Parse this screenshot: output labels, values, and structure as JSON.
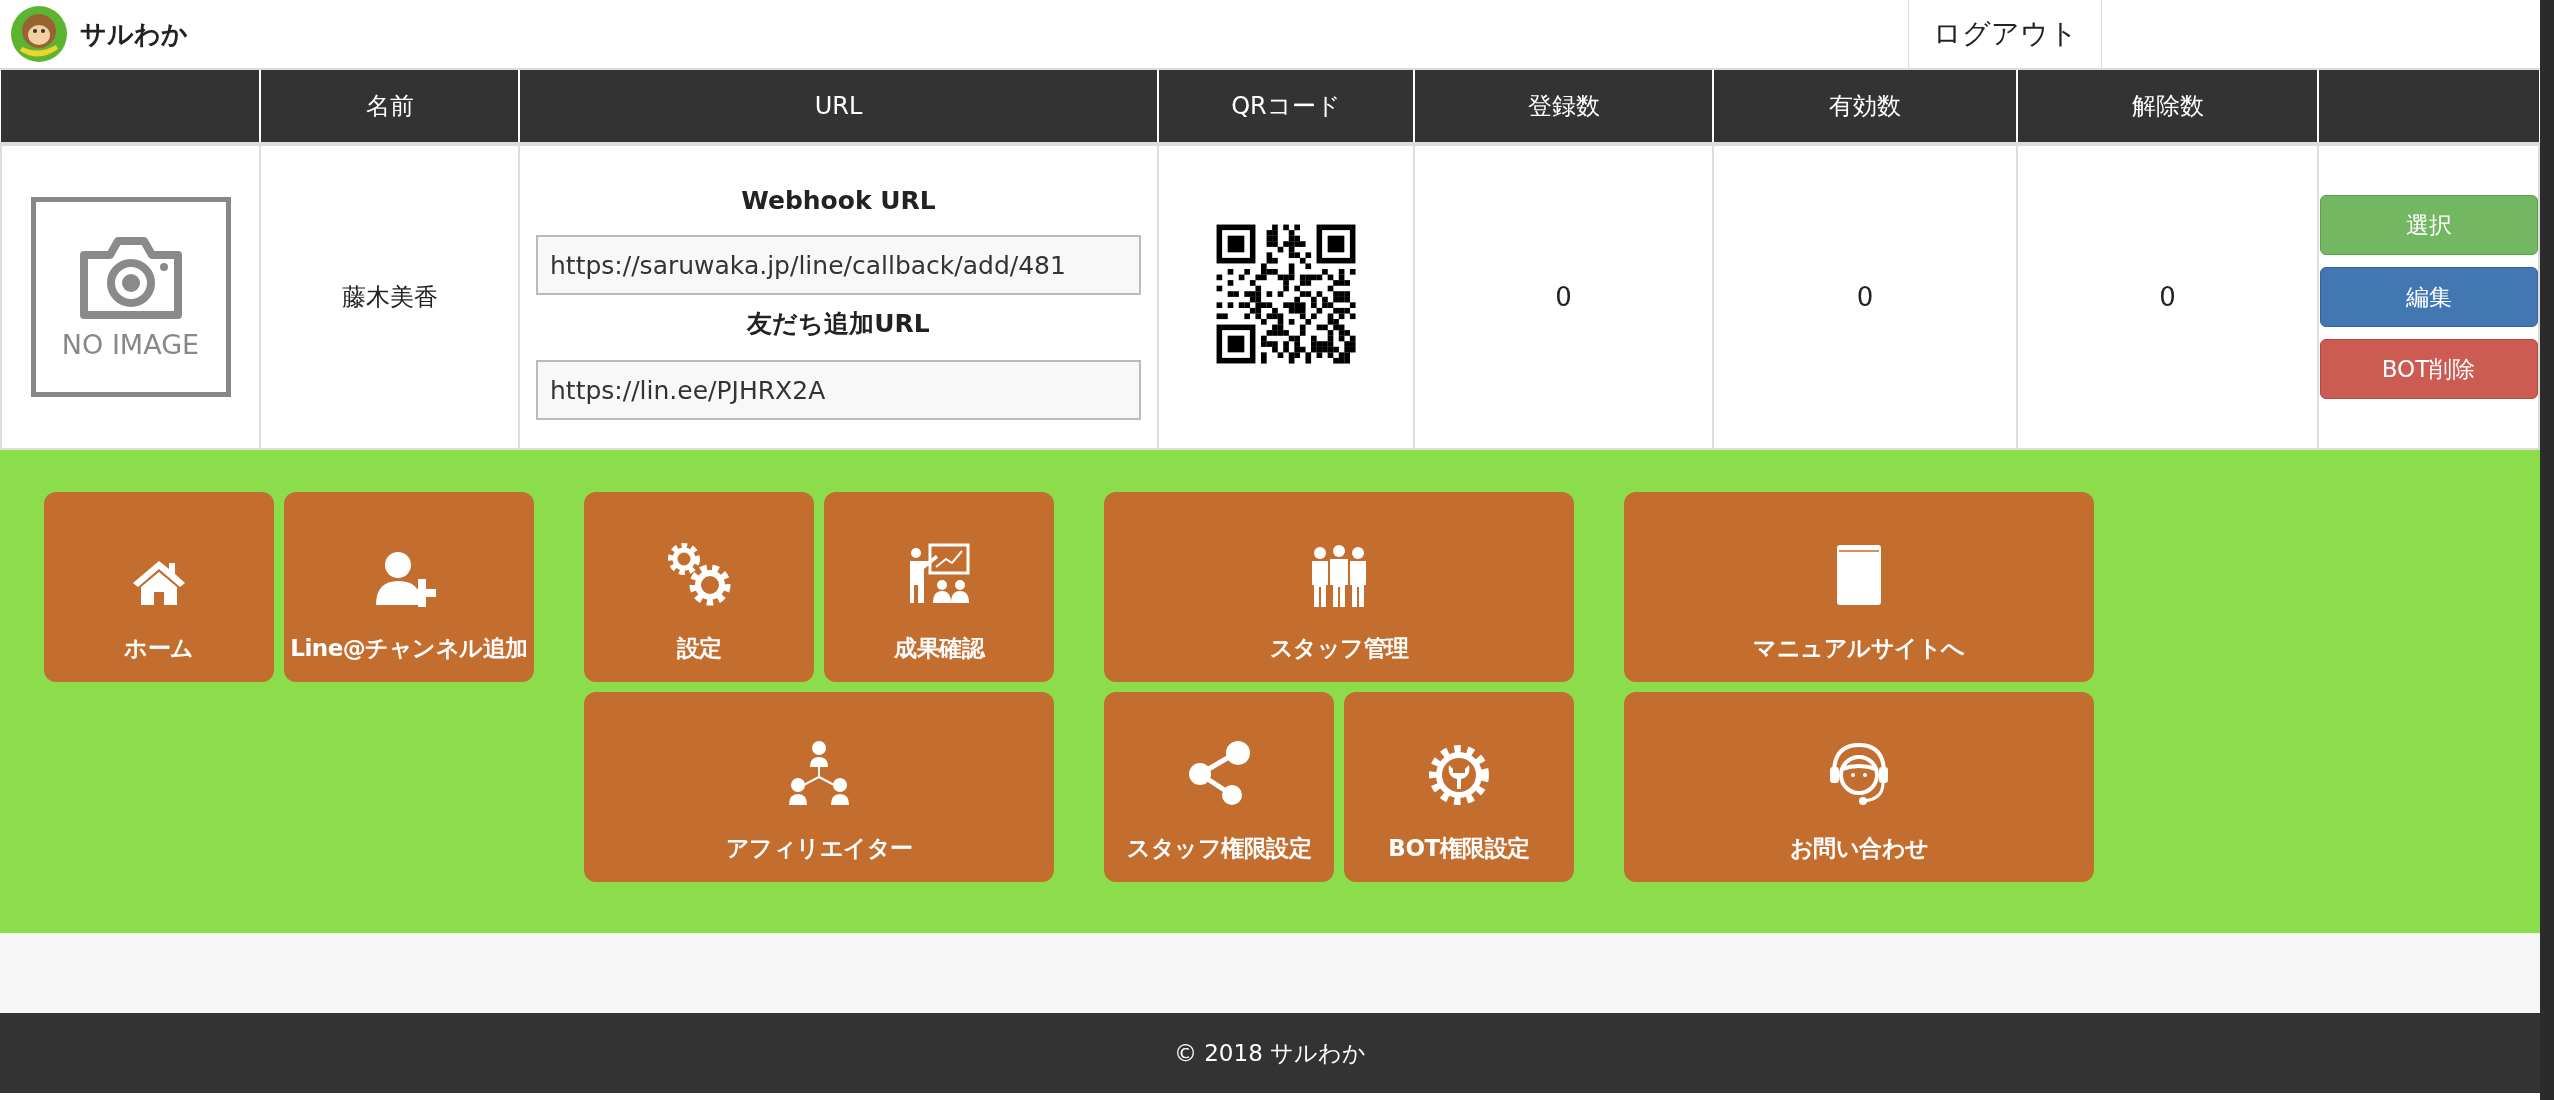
{
  "header": {
    "logo_text": "サルわか",
    "logout": "ログアウト"
  },
  "table": {
    "columns": [
      {},
      {
        "label": "名前"
      },
      {
        "label": "URL"
      },
      {
        "label": "QRコード"
      },
      {
        "label": "登録数"
      },
      {
        "label": "有効数"
      },
      {
        "label": "解除数"
      },
      {}
    ],
    "rows": [
      {
        "image_text": "NO IMAGE",
        "name": "藤木美香",
        "webhook_label": "Webhook URL",
        "webhook_url": "https://saruwaka.jp/line/callback/add/481",
        "friend_label": "友だち追加URL",
        "friend_url": "https://lin.ee/PJHRX2A",
        "registered": "0",
        "active": "0",
        "removed": "0",
        "actions": [
          {
            "label": "選択",
            "kind": "select"
          },
          {
            "label": "編集",
            "kind": "edit"
          },
          {
            "label": "BOT削除",
            "kind": "delete"
          }
        ]
      }
    ]
  },
  "menu": [
    [
      {
        "label": "ホーム"
      },
      {
        "label": "Line@チャンネル追加"
      }
    ],
    [
      {
        "label": "設定"
      },
      {
        "label": "成果確認"
      },
      {
        "label": "アフィリエイター"
      }
    ],
    [
      {
        "label": "スタッフ管理"
      },
      {
        "label": "スタッフ権限設定"
      },
      {
        "label": "BOT権限設定"
      }
    ],
    [
      {
        "label": "マニュアルサイトへ"
      },
      {
        "label": "お問い合わせ"
      }
    ]
  ],
  "footer": "© 2018 サルわか"
}
